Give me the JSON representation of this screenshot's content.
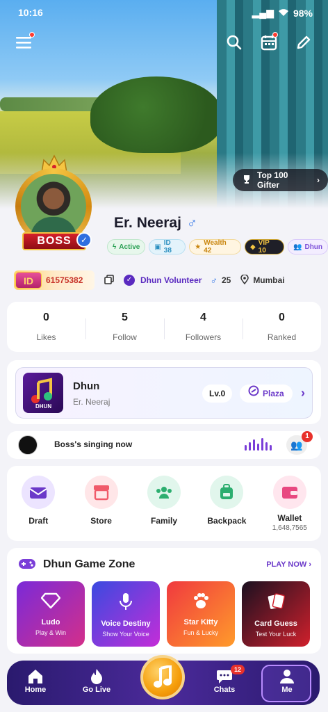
{
  "status": {
    "time": "10:16",
    "battery": "98%"
  },
  "header": {
    "top_gifter_label": "Top 100 Gifter"
  },
  "profile": {
    "frame_label": "BOSS",
    "name": "Er. Neeraj",
    "badges": [
      {
        "label": "Active"
      },
      {
        "label": "ID 38"
      },
      {
        "label": "Wealth 42"
      },
      {
        "label": "VIP 10"
      },
      {
        "label": "Dhun"
      }
    ],
    "id_logo": "ID",
    "id_number": "61575382",
    "volunteer": "Dhun Volunteer",
    "age": "25",
    "location": "Mumbai"
  },
  "stats": [
    {
      "value": "0",
      "label": "Likes"
    },
    {
      "value": "5",
      "label": "Follow"
    },
    {
      "value": "4",
      "label": "Followers"
    },
    {
      "value": "0",
      "label": "Ranked"
    }
  ],
  "room": {
    "name": "Dhun",
    "owner": "Er. Neeraj",
    "level": "Lv.0",
    "plaza": "Plaza",
    "thumb_text": "DHUN"
  },
  "live": {
    "text": "Boss's singing now",
    "member_badge": "1"
  },
  "quick": [
    {
      "label": "Draft",
      "sub": ""
    },
    {
      "label": "Store",
      "sub": ""
    },
    {
      "label": "Family",
      "sub": ""
    },
    {
      "label": "Backpack",
      "sub": ""
    },
    {
      "label": "Wallet",
      "sub": "1,648,7565"
    }
  ],
  "games": {
    "title": "Dhun Game Zone",
    "play_now": "PLAY NOW",
    "items": [
      {
        "name": "Ludo",
        "sub": "Play & Win"
      },
      {
        "name": "Voice Destiny",
        "sub": "Show Your Voice"
      },
      {
        "name": "Star Kitty",
        "sub": "Fun & Lucky"
      },
      {
        "name": "Card Guess",
        "sub": "Test Your Luck"
      }
    ]
  },
  "nav": {
    "home": "Home",
    "go_live": "Go Live",
    "chats": "Chats",
    "chats_badge": "12",
    "me": "Me"
  },
  "colors": {
    "accent": "#6b39c9",
    "nav_bg": "#2a1a6e",
    "badge_red": "#e8312b"
  }
}
